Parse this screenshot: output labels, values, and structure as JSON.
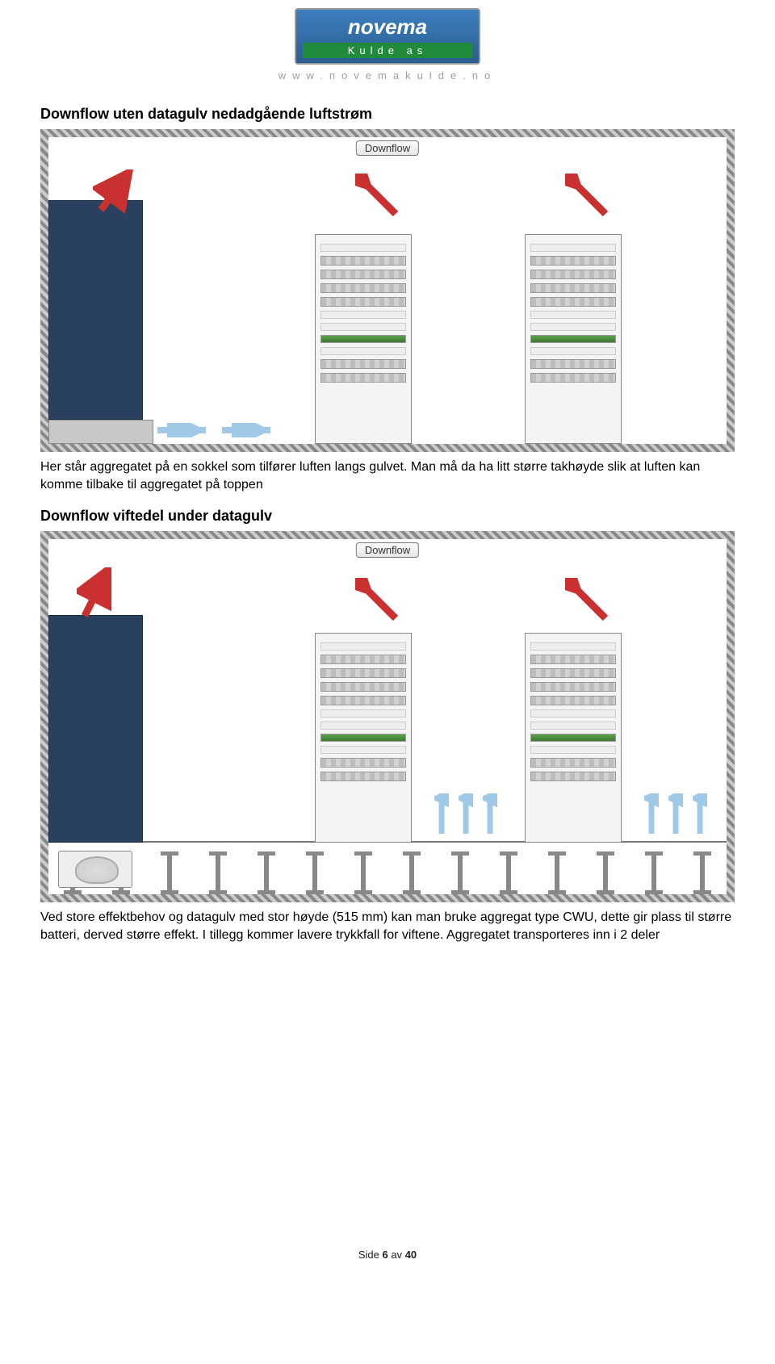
{
  "logo": {
    "top": "novema",
    "bottom": "Kulde as"
  },
  "url": "www.novemakulde.no",
  "section1": {
    "title": "Downflow  uten datagulv nedadgående luftstrøm",
    "badge": "Downflow",
    "text": "Her står aggregatet på en sokkel som tilfører luften langs gulvet. Man må da ha litt større takhøyde slik at luften kan komme tilbake til aggregatet på toppen"
  },
  "section2": {
    "title": "Downflow viftedel under datagulv",
    "badge": "Downflow",
    "text": "Ved store effektbehov og datagulv med stor høyde (515 mm) kan man bruke aggregat type CWU, dette gir plass til større batteri, derved større effekt. I tillegg kommer lavere trykkfall for viftene. Aggregatet transporteres inn i 2 deler"
  },
  "footer": {
    "prefix": "Side ",
    "page": "6",
    "sep": " av ",
    "total": "40"
  }
}
